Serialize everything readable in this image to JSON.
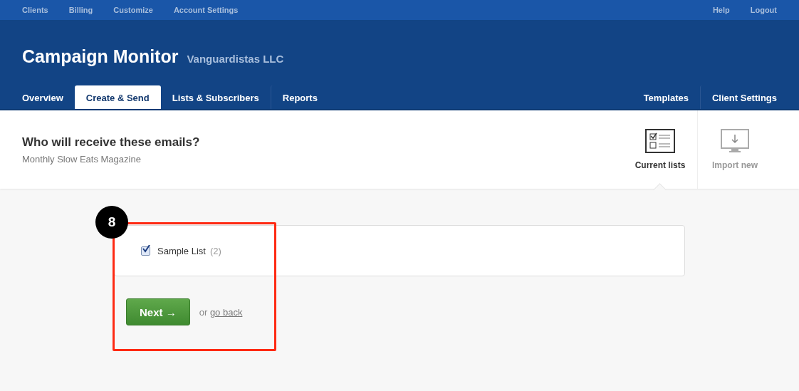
{
  "top_nav": {
    "left": [
      "Clients",
      "Billing",
      "Customize",
      "Account Settings"
    ],
    "right": [
      "Help",
      "Logout"
    ]
  },
  "header": {
    "title": "Campaign Monitor",
    "client": "Vanguardistas LLC"
  },
  "tabs": [
    {
      "label": "Overview",
      "selected": false
    },
    {
      "label": "Create & Send",
      "selected": true
    },
    {
      "label": "Lists & Subscribers",
      "selected": false
    },
    {
      "label": "Reports",
      "selected": false
    }
  ],
  "right_tabs": [
    "Templates",
    "Client Settings"
  ],
  "step": {
    "heading": "Who will receive these emails?",
    "subtitle": "Monthly Slow Eats Magazine"
  },
  "views": [
    {
      "kind": "lists",
      "label": "Current lists",
      "selected": true
    },
    {
      "kind": "import",
      "label": "Import new",
      "selected": false
    }
  ],
  "lists": [
    {
      "name": "Sample List",
      "count": "(2)",
      "checked": true
    }
  ],
  "actions": {
    "next": "Next →",
    "or": "or",
    "back": "go back"
  },
  "annotation": {
    "number": "8"
  }
}
